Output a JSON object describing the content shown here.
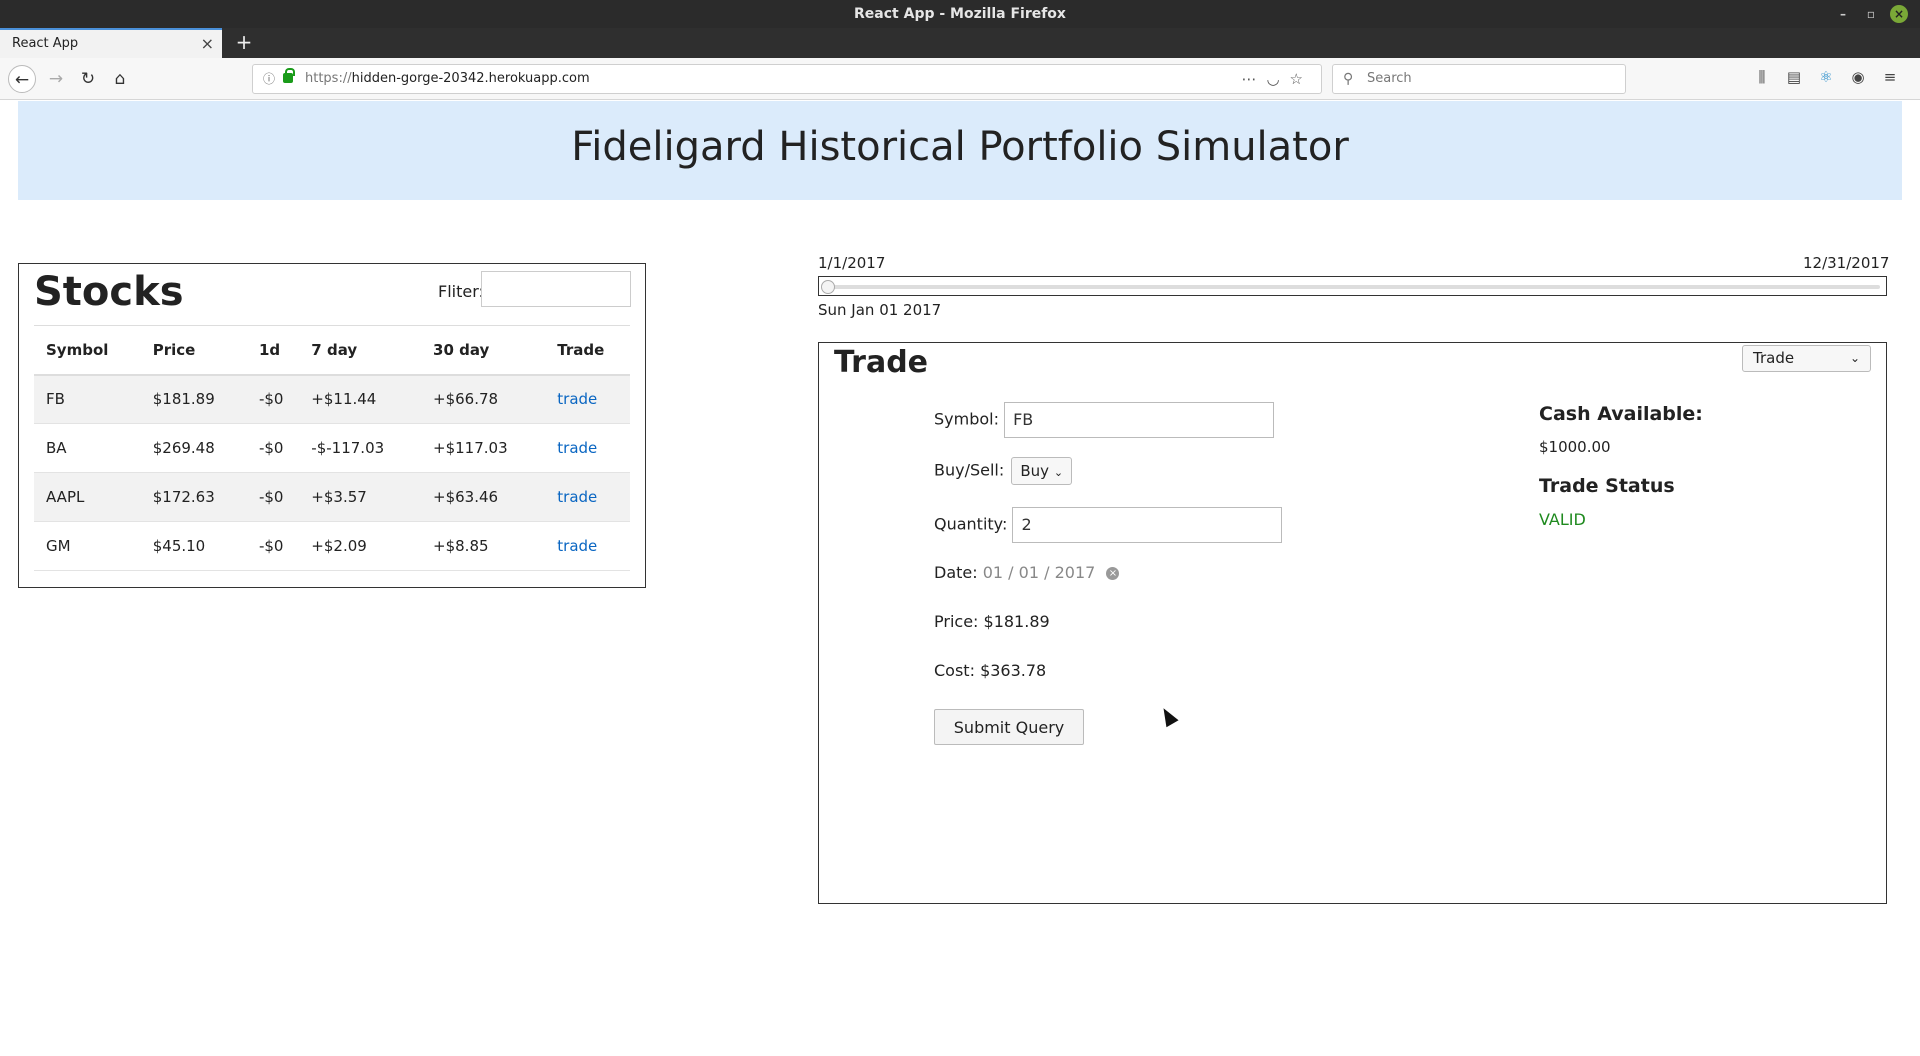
{
  "window": {
    "title": "React App - Mozilla Firefox"
  },
  "browser": {
    "tab_title": "React App",
    "url_protocol": "https://",
    "url_host": "hidden-gorge-20342.herokuapp.com",
    "search_placeholder": "Search"
  },
  "header": {
    "title": "Fideligard Historical Portfolio Simulator"
  },
  "stocks": {
    "title": "Stocks",
    "filter_label": "Fliter:",
    "filter_value": "",
    "columns": [
      "Symbol",
      "Price",
      "1d",
      "7 day",
      "30 day",
      "Trade"
    ],
    "rows": [
      {
        "symbol": "FB",
        "price": "$181.89",
        "d1": "-$0",
        "d7": "+$11.44",
        "d30": "+$66.78",
        "trade": "trade"
      },
      {
        "symbol": "BA",
        "price": "$269.48",
        "d1": "-$0",
        "d7": "-$-117.03",
        "d30": "+$117.03",
        "trade": "trade"
      },
      {
        "symbol": "AAPL",
        "price": "$172.63",
        "d1": "-$0",
        "d7": "+$3.57",
        "d30": "+$63.46",
        "trade": "trade"
      },
      {
        "symbol": "GM",
        "price": "$45.10",
        "d1": "-$0",
        "d7": "+$2.09",
        "d30": "+$8.85",
        "trade": "trade"
      }
    ]
  },
  "slider": {
    "start_label": "1/1/2017",
    "end_label": "12/31/2017",
    "position": 0,
    "current_date": "Sun Jan 01 2017"
  },
  "trade": {
    "title": "Trade",
    "view_select": "Trade",
    "symbol_label": "Symbol:",
    "symbol_value": "FB",
    "buysell_label": "Buy/Sell:",
    "buysell_value": "Buy",
    "quantity_label": "Quantity:",
    "quantity_value": "2",
    "date_label": "Date:",
    "date_value": "01 / 01 / 2017",
    "price_label": "Price:",
    "price_value": "$181.89",
    "cost_label": "Cost:",
    "cost_value": "$363.78",
    "submit_label": "Submit Query",
    "cash_title": "Cash Available:",
    "cash_value": "$1000.00",
    "status_title": "Trade Status",
    "status_value": "VALID",
    "status_color": "#1f8a1f"
  }
}
